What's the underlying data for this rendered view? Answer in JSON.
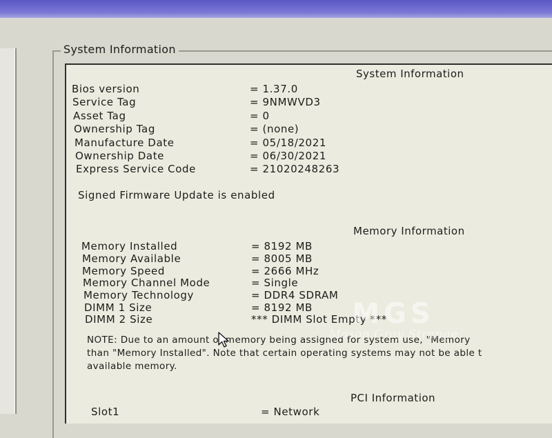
{
  "group": {
    "title": "System Information"
  },
  "system": {
    "title": "System Information",
    "rows": [
      {
        "label": "Bios version",
        "value": "= 1.37.0"
      },
      {
        "label": "Service Tag",
        "value": "= 9NMWVD3"
      },
      {
        "label": "Asset Tag",
        "value": "= 0"
      },
      {
        "label": "Ownership Tag",
        "value": "= (none)"
      },
      {
        "label": "Manufacture Date",
        "value": "= 05/18/2021"
      },
      {
        "label": "Ownership Date",
        "value": "= 06/30/2021"
      },
      {
        "label": "Express Service Code",
        "value": "= 21020248263"
      }
    ],
    "signed_firmware": "Signed Firmware Update is enabled"
  },
  "memory": {
    "title": "Memory Information",
    "rows": [
      {
        "label": "Memory Installed",
        "value": "= 8192 MB"
      },
      {
        "label": "Memory Available",
        "value": "= 8005 MB"
      },
      {
        "label": "Memory Speed",
        "value": "= 2666 MHz"
      },
      {
        "label": "Memory Channel Mode",
        "value": "= Single"
      },
      {
        "label": "Memory Technology",
        "value": "= DDR4 SDRAM"
      },
      {
        "label": "DIMM 1 Size",
        "value": "= 8192 MB"
      },
      {
        "label": "DIMM 2 Size",
        "value": "*** DIMM Slot Empty ***"
      }
    ],
    "note_lines": [
      "NOTE: Due to an amount of memory being assigned for system use, \"Memory",
      "than \"Memory Installed\". Note that certain operating systems may not be able t",
      "available memory."
    ]
  },
  "pci": {
    "title": "PCI Information",
    "rows": [
      {
        "label": "Slot1",
        "value": "= Network"
      }
    ]
  },
  "watermark": {
    "logo": "MGS",
    "text": "Mason Gray Strange"
  },
  "colors": {
    "panel_bg": "#ecebdf",
    "window_bg": "#d9d8cf",
    "top_bar": "#6b67cf"
  }
}
